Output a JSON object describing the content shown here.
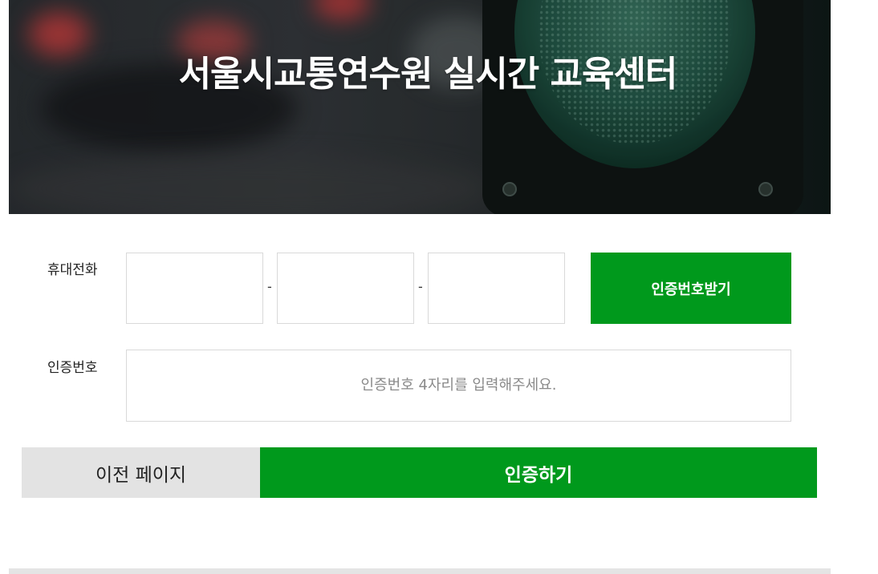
{
  "hero": {
    "title": "서울시교통연수원 실시간 교육센터"
  },
  "form": {
    "phone": {
      "label": "휴대전화",
      "separator": "-",
      "part1": "",
      "part2": "",
      "part3": "",
      "send_button": "인증번호받기"
    },
    "code": {
      "label": "인증번호",
      "value": "",
      "placeholder": "인증번호 4자리를 입력해주세요."
    }
  },
  "actions": {
    "prev_label": "이전 페이지",
    "verify_label": "인증하기"
  },
  "colors": {
    "accent_green": "#00991c",
    "secondary_button": "#e3e3e3",
    "input_border": "#d9d9d9"
  }
}
